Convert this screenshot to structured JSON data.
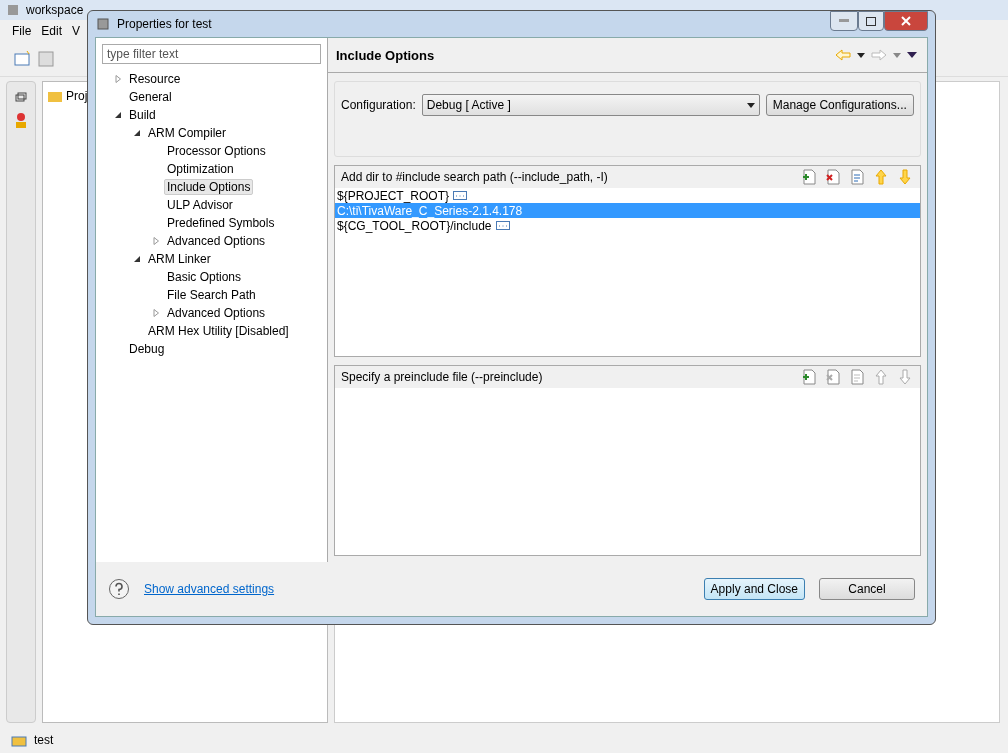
{
  "app": {
    "title": "workspace",
    "menu": [
      "File",
      "Edit",
      "V"
    ],
    "project_tab": "Proj",
    "status": "test"
  },
  "dialog": {
    "title": "Properties for test",
    "filter": {
      "placeholder": "type filter text"
    },
    "tree": [
      {
        "label": "Resource",
        "expanded": false,
        "selected": false
      },
      {
        "label": "General",
        "selected": false
      },
      {
        "label": "Build",
        "expanded": true,
        "selected": false,
        "children": [
          {
            "label": "ARM Compiler",
            "expanded": true,
            "selected": false,
            "children": [
              {
                "label": "Processor Options",
                "selected": false
              },
              {
                "label": "Optimization",
                "selected": false
              },
              {
                "label": "Include Options",
                "selected": true
              },
              {
                "label": "ULP Advisor",
                "selected": false
              },
              {
                "label": "Predefined Symbols",
                "selected": false
              },
              {
                "label": "Advanced Options",
                "expanded": false,
                "selected": false
              }
            ]
          },
          {
            "label": "ARM Linker",
            "expanded": true,
            "selected": false,
            "children": [
              {
                "label": "Basic Options",
                "selected": false
              },
              {
                "label": "File Search Path",
                "selected": false
              },
              {
                "label": "Advanced Options",
                "expanded": false,
                "selected": false
              }
            ]
          },
          {
            "label": "ARM Hex Utility  [Disabled]",
            "selected": false
          }
        ]
      },
      {
        "label": "Debug",
        "selected": false
      }
    ],
    "page_title": "Include Options",
    "configuration": {
      "label": "Configuration:",
      "value": "Debug  [ Active ]",
      "button": "Manage Configurations..."
    },
    "lists": [
      {
        "title": "Add dir to #include search path (--include_path, -I)",
        "tools": [
          {
            "kind": "add",
            "enabled": true
          },
          {
            "kind": "delete",
            "enabled": true
          },
          {
            "kind": "edit",
            "enabled": true
          },
          {
            "kind": "up",
            "enabled": true
          },
          {
            "kind": "down",
            "enabled": true
          }
        ],
        "items": [
          {
            "text": "${PROJECT_ROOT}",
            "variable": true,
            "selected": false
          },
          {
            "text": "C:\\ti\\TivaWare_C_Series-2.1.4.178",
            "variable": false,
            "selected": true
          },
          {
            "text": "${CG_TOOL_ROOT}/include",
            "variable": true,
            "selected": false
          }
        ]
      },
      {
        "title": "Specify a preinclude file (--preinclude)",
        "tools": [
          {
            "kind": "add",
            "enabled": true
          },
          {
            "kind": "delete",
            "enabled": false
          },
          {
            "kind": "edit",
            "enabled": false
          },
          {
            "kind": "up",
            "enabled": false
          },
          {
            "kind": "down",
            "enabled": false
          }
        ]
      }
    ],
    "help_link": "Show advanced settings",
    "buttons": [
      {
        "label": "Apply and Close",
        "default": true
      },
      {
        "label": "Cancel",
        "default": false
      }
    ]
  }
}
